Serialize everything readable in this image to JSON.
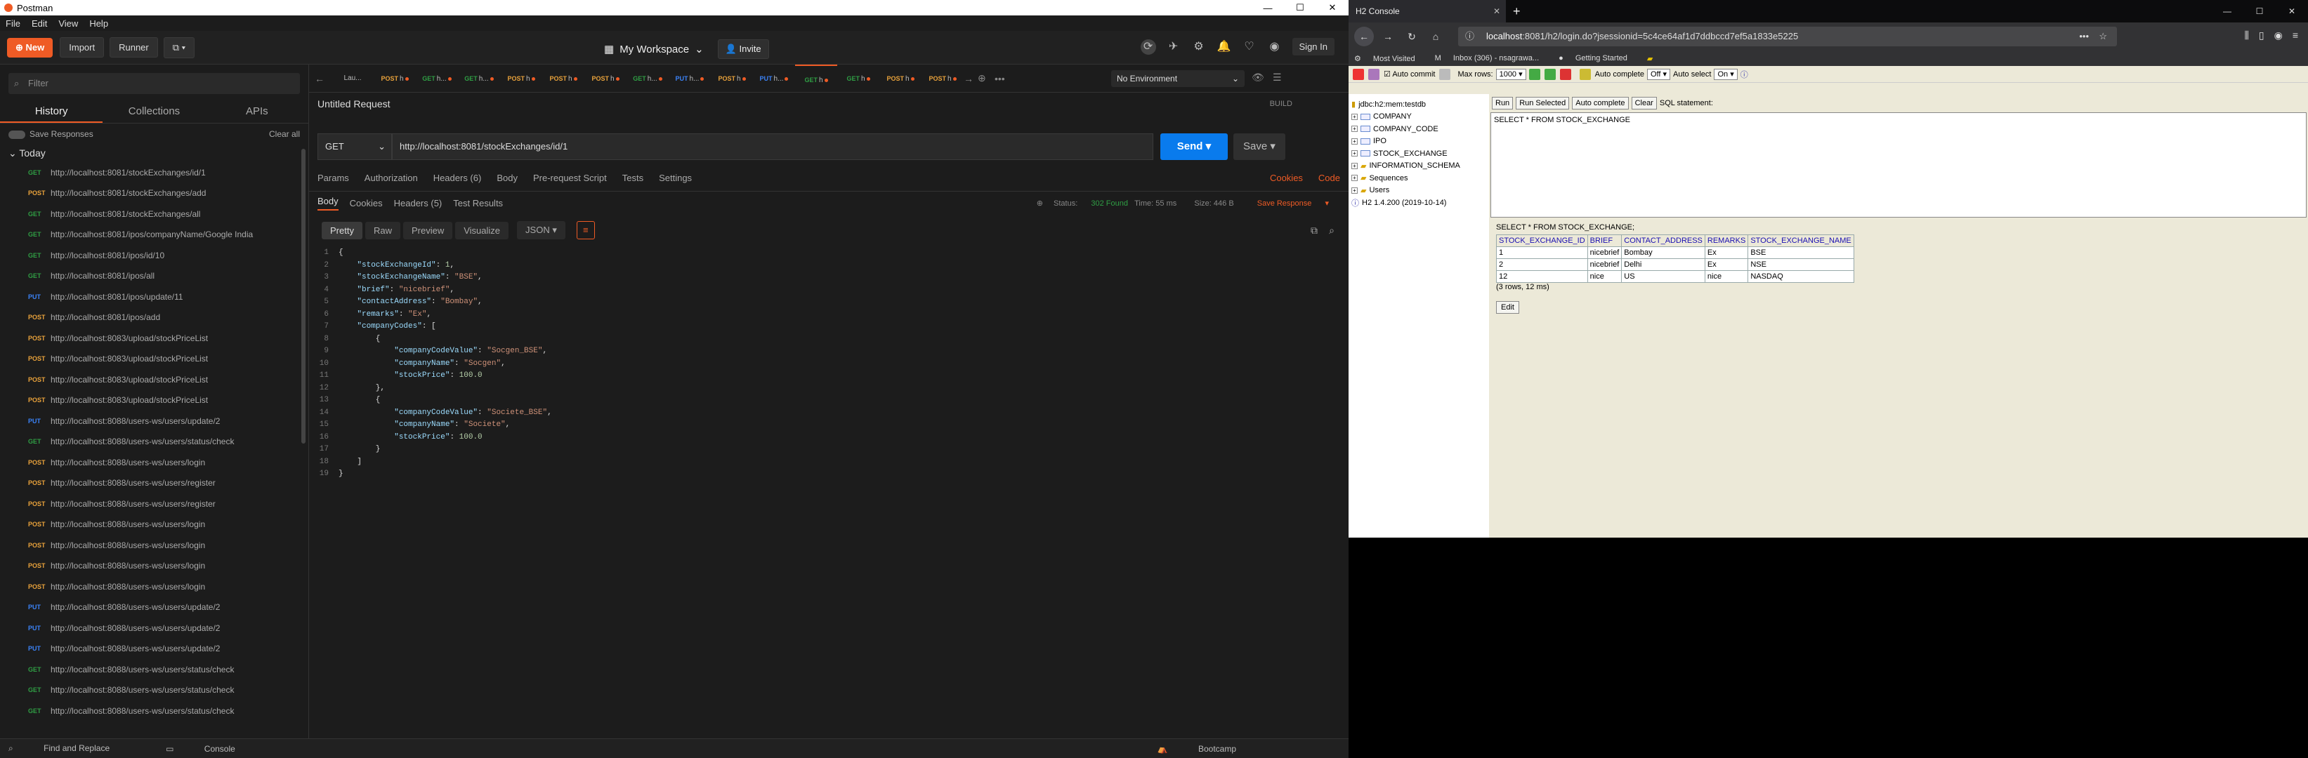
{
  "postman": {
    "title": "Postman",
    "menu": [
      "File",
      "Edit",
      "View",
      "Help"
    ],
    "toolbar": {
      "new": "New",
      "import": "Import",
      "runner": "Runner",
      "workspace": "My Workspace",
      "invite": "Invite",
      "signin": "Sign In"
    },
    "sidebar": {
      "filter_placeholder": "Filter",
      "tabs": [
        "History",
        "Collections",
        "APIs"
      ],
      "save_responses": "Save Responses",
      "clear_all": "Clear all",
      "today": "Today",
      "history": [
        {
          "method": "GET",
          "url": "http://localhost:8081/stockExchanges/id/1"
        },
        {
          "method": "POST",
          "url": "http://localhost:8081/stockExchanges/add"
        },
        {
          "method": "GET",
          "url": "http://localhost:8081/stockExchanges/all"
        },
        {
          "method": "GET",
          "url": "http://localhost:8081/ipos/companyName/Google India"
        },
        {
          "method": "GET",
          "url": "http://localhost:8081/ipos/id/10"
        },
        {
          "method": "GET",
          "url": "http://localhost:8081/ipos/all"
        },
        {
          "method": "PUT",
          "url": "http://localhost:8081/ipos/update/11"
        },
        {
          "method": "POST",
          "url": "http://localhost:8081/ipos/add"
        },
        {
          "method": "POST",
          "url": "http://localhost:8083/upload/stockPriceList"
        },
        {
          "method": "POST",
          "url": "http://localhost:8083/upload/stockPriceList"
        },
        {
          "method": "POST",
          "url": "http://localhost:8083/upload/stockPriceList"
        },
        {
          "method": "POST",
          "url": "http://localhost:8083/upload/stockPriceList"
        },
        {
          "method": "PUT",
          "url": "http://localhost:8088/users-ws/users/update/2"
        },
        {
          "method": "GET",
          "url": "http://localhost:8088/users-ws/users/status/check"
        },
        {
          "method": "POST",
          "url": "http://localhost:8088/users-ws/users/login"
        },
        {
          "method": "POST",
          "url": "http://localhost:8088/users-ws/users/register"
        },
        {
          "method": "POST",
          "url": "http://localhost:8088/users-ws/users/register"
        },
        {
          "method": "POST",
          "url": "http://localhost:8088/users-ws/users/login"
        },
        {
          "method": "POST",
          "url": "http://localhost:8088/users-ws/users/login"
        },
        {
          "method": "POST",
          "url": "http://localhost:8088/users-ws/users/login"
        },
        {
          "method": "POST",
          "url": "http://localhost:8088/users-ws/users/login"
        },
        {
          "method": "PUT",
          "url": "http://localhost:8088/users-ws/users/update/2"
        },
        {
          "method": "PUT",
          "url": "http://localhost:8088/users-ws/users/update/2"
        },
        {
          "method": "PUT",
          "url": "http://localhost:8088/users-ws/users/update/2"
        },
        {
          "method": "GET",
          "url": "http://localhost:8088/users-ws/users/status/check"
        },
        {
          "method": "GET",
          "url": "http://localhost:8088/users-ws/users/status/check"
        },
        {
          "method": "GET",
          "url": "http://localhost:8088/users-ws/users/status/check"
        }
      ]
    },
    "req_tabs": [
      {
        "method": "",
        "label": "Lau..."
      },
      {
        "method": "POST",
        "label": "h"
      },
      {
        "method": "GET",
        "label": "h..."
      },
      {
        "method": "GET",
        "label": "h..."
      },
      {
        "method": "POST",
        "label": "h"
      },
      {
        "method": "POST",
        "label": "h"
      },
      {
        "method": "POST",
        "label": "h"
      },
      {
        "method": "GET",
        "label": "h..."
      },
      {
        "method": "PUT",
        "label": "h..."
      },
      {
        "method": "POST",
        "label": "h"
      },
      {
        "method": "PUT",
        "label": "h..."
      },
      {
        "method": "GET",
        "label": "h"
      },
      {
        "method": "GET",
        "label": "h"
      },
      {
        "method": "POST",
        "label": "h"
      },
      {
        "method": "POST",
        "label": "h"
      }
    ],
    "environment": "No Environment",
    "request": {
      "title": "Untitled Request",
      "build": "BUILD",
      "method": "GET",
      "url": "http://localhost:8081/stockExchanges/id/1",
      "send": "Send",
      "save": "Save",
      "tabs": [
        "Params",
        "Authorization",
        "Headers (6)",
        "Body",
        "Pre-request Script",
        "Tests",
        "Settings"
      ],
      "cookies": "Cookies",
      "code": "Code"
    },
    "response": {
      "tabs": [
        "Body",
        "Cookies",
        "Headers (5)",
        "Test Results"
      ],
      "status_label": "Status:",
      "status_value": "302 Found",
      "time": "Time: 55 ms",
      "size": "Size: 446 B",
      "save_response": "Save Response",
      "formats": [
        "Pretty",
        "Raw",
        "Preview",
        "Visualize"
      ],
      "format_select": "JSON",
      "lines": [
        "{",
        "    \"stockExchangeId\": 1,",
        "    \"stockExchangeName\": \"BSE\",",
        "    \"brief\": \"nicebrief\",",
        "    \"contactAddress\": \"Bombay\",",
        "    \"remarks\": \"Ex\",",
        "    \"companyCodes\": [",
        "        {",
        "            \"companyCodeValue\": \"Socgen_BSE\",",
        "            \"companyName\": \"Socgen\",",
        "            \"stockPrice\": 100.0",
        "        },",
        "        {",
        "            \"companyCodeValue\": \"Societe_BSE\",",
        "            \"companyName\": \"Societe\",",
        "            \"stockPrice\": 100.0",
        "        }",
        "    ]",
        "}"
      ]
    },
    "statusbar": {
      "find": "Find and Replace",
      "console": "Console",
      "bootcamp": "Bootcamp"
    }
  },
  "firefox": {
    "tab_title": "H2 Console",
    "url_host": "localhost",
    "url_rest": ":8081/h2/login.do?jsessionid=5c4ce64af1d7ddbccd7ef5a1833e5225",
    "bookmarks": [
      "Most Visited",
      "Inbox (306) - nsagrawa...",
      "Getting Started"
    ],
    "h2": {
      "auto_commit": "Auto commit",
      "max_rows_label": "Max rows:",
      "max_rows": "1000",
      "auto_complete_label": "Auto complete",
      "auto_complete": "Off",
      "auto_select_label": "Auto select",
      "auto_select": "On",
      "tree": [
        {
          "label": "jdbc:h2:mem:testdb",
          "kind": "db"
        },
        {
          "label": "COMPANY",
          "kind": "table"
        },
        {
          "label": "COMPANY_CODE",
          "kind": "table"
        },
        {
          "label": "IPO",
          "kind": "table"
        },
        {
          "label": "STOCK_EXCHANGE",
          "kind": "table"
        },
        {
          "label": "INFORMATION_SCHEMA",
          "kind": "folder"
        },
        {
          "label": "Sequences",
          "kind": "folder"
        },
        {
          "label": "Users",
          "kind": "folder"
        },
        {
          "label": "H2 1.4.200 (2019-10-14)",
          "kind": "info"
        }
      ],
      "buttons": [
        "Run",
        "Run Selected",
        "Auto complete",
        "Clear"
      ],
      "sql_label": "SQL statement:",
      "sql": "SELECT * FROM STOCK_EXCHANGE",
      "result_sql": "SELECT * FROM STOCK_EXCHANGE;",
      "columns": [
        "STOCK_EXCHANGE_ID",
        "BRIEF",
        "CONTACT_ADDRESS",
        "REMARKS",
        "STOCK_EXCHANGE_NAME"
      ],
      "rows": [
        [
          "1",
          "nicebrief",
          "Bombay",
          "Ex",
          "BSE"
        ],
        [
          "2",
          "nicebrief",
          "Delhi",
          "Ex",
          "NSE"
        ],
        [
          "12",
          "nice",
          "US",
          "nice",
          "NASDAQ"
        ]
      ],
      "row_count": "(3 rows, 12 ms)",
      "edit": "Edit"
    }
  }
}
